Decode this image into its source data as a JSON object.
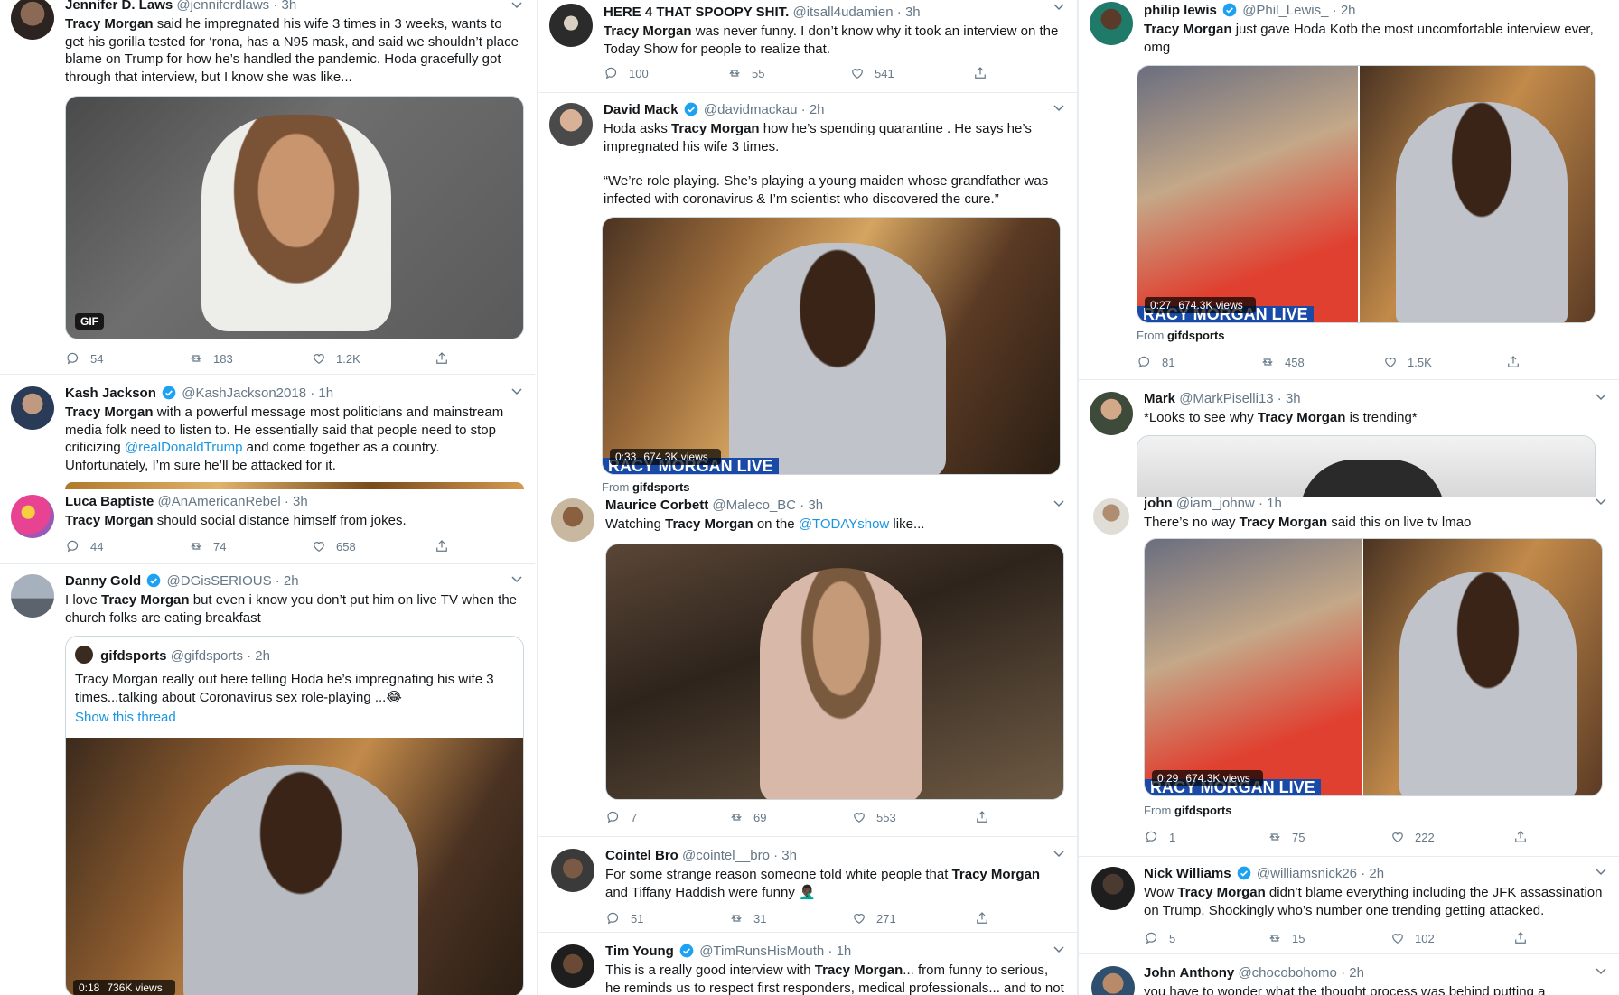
{
  "columns": [
    {
      "tweets": [
        {
          "name": "Jennifer D. Laws",
          "handle": "@jenniferdlaws",
          "time": "· 3h",
          "text_parts": [
            {
              "t": "Tracy Morgan",
              "b": true
            },
            {
              "t": " said he impregnated his wife 3 times in 3 weeks, wants to get his gorilla tested for ‘rona, has a N95 mask, and said we shouldn’t place blame on Trump for how he’s handled the pandemic. Hoda gracefully got through that interview, but I know she was like..."
            }
          ],
          "media_badge": "GIF",
          "replies": "54",
          "retweets": "183",
          "likes": "1.2K"
        },
        {
          "name": "Kash Jackson",
          "handle": "@KashJackson2018",
          "time": "· 1h",
          "verified": true,
          "text_parts": [
            {
              "t": "Tracy Morgan",
              "b": true
            },
            {
              "t": " with a powerful message most politicians and mainstream media folk need to listen to. He essentially said that people need to stop criticizing "
            },
            {
              "t": "@realDonaldTrump",
              "link": true
            },
            {
              "t": " and come together as a country. Unfortunately, I’m sure he’ll be attacked for it."
            }
          ]
        },
        {
          "name": "Luca Baptiste",
          "handle": "@AnAmericanRebel",
          "time": "· 3h",
          "text_parts": [
            {
              "t": "Tracy Morgan",
              "b": true
            },
            {
              "t": " should social distance himself from jokes."
            }
          ],
          "replies": "44",
          "retweets": "74",
          "likes": "658"
        },
        {
          "name": "Danny Gold",
          "handle": "@DGisSERIOUS",
          "time": "· 2h",
          "verified": true,
          "text_parts": [
            {
              "t": "I love "
            },
            {
              "t": "Tracy Morgan",
              "b": true
            },
            {
              "t": " but even i know you don’t put him on live TV when the church folks are eating breakfast"
            }
          ],
          "quote": {
            "name": "gifdsports",
            "handle": "@gifdsports",
            "time": "· 2h",
            "text": "Tracy Morgan really out here telling Hoda he’s impregnating his wife 3 times...talking about Coronavirus sex role-playing ...😂",
            "show_thread": "Show this thread",
            "duration": "0:18",
            "views": "736K views"
          }
        }
      ]
    },
    {
      "tweets": [
        {
          "name": "HERE 4 THAT SPOOPY SHIT.",
          "handle": "@itsall4udamien",
          "time": "· 3h",
          "text_parts": [
            {
              "t": "Tracy Morgan",
              "b": true
            },
            {
              "t": " was never funny. I don’t know why it took an interview on the Today Show for people to realize that."
            }
          ],
          "replies": "100",
          "retweets": "55",
          "likes": "541"
        },
        {
          "name": "David Mack",
          "handle": "@davidmackau",
          "time": "· 2h",
          "verified": true,
          "text_parts": [
            {
              "t": "Hoda asks "
            },
            {
              "t": "Tracy Morgan",
              "b": true
            },
            {
              "t": " how he’s spending quarantine . He says he’s impregnated his wife 3 times."
            }
          ],
          "text2": "“We’re role playing. She’s playing a young maiden whose grandfather was infected with coronavirus & I’m scientist who discovered the cure.”",
          "duration": "0:33",
          "views": "674.3K views",
          "from_label": "From",
          "from_name": "gifdsports"
        },
        {
          "name": "Maurice Corbett",
          "handle": "@Maleco_BC",
          "time": "· 3h",
          "text_parts": [
            {
              "t": "Watching "
            },
            {
              "t": "Tracy Morgan",
              "b": true
            },
            {
              "t": " on the "
            },
            {
              "t": "@TODAYshow",
              "link": true
            },
            {
              "t": " like..."
            }
          ],
          "replies": "7",
          "retweets": "69",
          "likes": "553"
        },
        {
          "name": "Cointel Bro",
          "handle": "@cointel__bro",
          "time": "· 3h",
          "text_parts": [
            {
              "t": "For some strange reason someone told white people that "
            },
            {
              "t": "Tracy Morgan",
              "b": true
            },
            {
              "t": " and Tiffany Haddish were funny 🤦🏿‍♂️"
            }
          ],
          "replies": "51",
          "retweets": "31",
          "likes": "271"
        },
        {
          "name": "Tim Young",
          "handle": "@TimRunsHisMouth",
          "time": "· 1h",
          "verified": true,
          "text_parts": [
            {
              "t": "This is a really good interview with "
            },
            {
              "t": "Tracy Morgan",
              "b": true
            },
            {
              "t": "... from funny to serious, he reminds us to respect first responders, medical professionals... and to not"
            }
          ]
        }
      ]
    },
    {
      "tweets": [
        {
          "name": "philip lewis",
          "handle": "@Phil_Lewis_",
          "time": "· 2h",
          "verified": true,
          "text_parts": [
            {
              "t": "Tracy Morgan",
              "b": true
            },
            {
              "t": " just gave Hoda Kotb the most uncomfortable interview ever, omg"
            }
          ],
          "duration": "0:27",
          "views": "674.3K views",
          "from_label": "From",
          "from_name": "gifdsports",
          "replies": "81",
          "retweets": "458",
          "likes": "1.5K"
        },
        {
          "name": "Mark",
          "handle": "@MarkPiselli13",
          "time": "· 3h",
          "text_parts": [
            {
              "t": "*Looks to see why "
            },
            {
              "t": "Tracy Morgan",
              "b": true
            },
            {
              "t": " is trending*"
            }
          ]
        },
        {
          "name": "john",
          "handle": "@iam_johnw",
          "time": "· 1h",
          "text_parts": [
            {
              "t": "There’s no way "
            },
            {
              "t": "Tracy Morgan",
              "b": true
            },
            {
              "t": " said this on live tv lmao"
            }
          ],
          "duration": "0:29",
          "views": "674.3K views",
          "from_label": "From",
          "from_name": "gifdsports",
          "replies": "1",
          "retweets": "75",
          "likes": "222"
        },
        {
          "name": "Nick Williams",
          "handle": "@williamsnick26",
          "time": "· 2h",
          "verified": true,
          "text_parts": [
            {
              "t": "Wow "
            },
            {
              "t": "Tracy Morgan",
              "b": true
            },
            {
              "t": " didn’t blame everything including the JFK assassination on Trump. Shockingly who’s number one trending getting attacked."
            }
          ],
          "replies": "5",
          "retweets": "15",
          "likes": "102"
        },
        {
          "name": "John Anthony",
          "handle": "@chocobohomo",
          "time": "· 2h",
          "text_parts": [
            {
              "t": "you have to wonder what the thought process was behind putting a"
            }
          ]
        }
      ]
    }
  ],
  "chyron": "RACY MORGAN LIVE",
  "colors": {
    "link": "#1b95e0",
    "secondary": "#657786",
    "verified": "#1da1f2",
    "border": "#e6ecf0"
  }
}
